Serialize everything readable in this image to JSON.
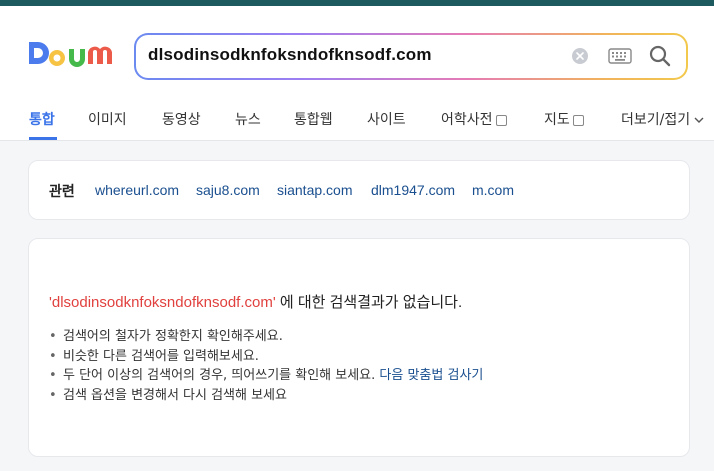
{
  "search": {
    "query": "dlsodinsodknfoksndofknsodf.com"
  },
  "logo": {
    "text": "Daum"
  },
  "tabs": [
    {
      "label": "통합",
      "active": true
    },
    {
      "label": "이미지"
    },
    {
      "label": "동영상"
    },
    {
      "label": "뉴스"
    },
    {
      "label": "통합웹"
    },
    {
      "label": "사이트"
    },
    {
      "label": "어학사전",
      "external": true
    },
    {
      "label": "지도",
      "external": true
    },
    {
      "label": "더보기/접기",
      "chevron": true
    }
  ],
  "related": {
    "label": "관련",
    "links": [
      "whereurl.com",
      "saju8.com",
      "siantap.com",
      "dlm1947.com",
      "m.com"
    ]
  },
  "noresult": {
    "query_quoted": "'dlsodinsodknfoksndofknsodf.com'",
    "message": " 에 대한 검색결과가 없습니다.",
    "tips": [
      "검색어의 철자가 정확한지 확인해주세요.",
      "비슷한 다른 검색어를 입력해보세요.",
      "두 단어 이상의 검색어의 경우, 띄어쓰기를 확인해 보세요.",
      "검색 옵션을 변경해서 다시 검색해 보세요"
    ],
    "spell_link": "다음 맞춤법 검사기",
    "bullet": "•"
  },
  "colors": {
    "accent": "#3b74e8",
    "query_red": "#e0413e",
    "link": "#1a4f8f"
  }
}
